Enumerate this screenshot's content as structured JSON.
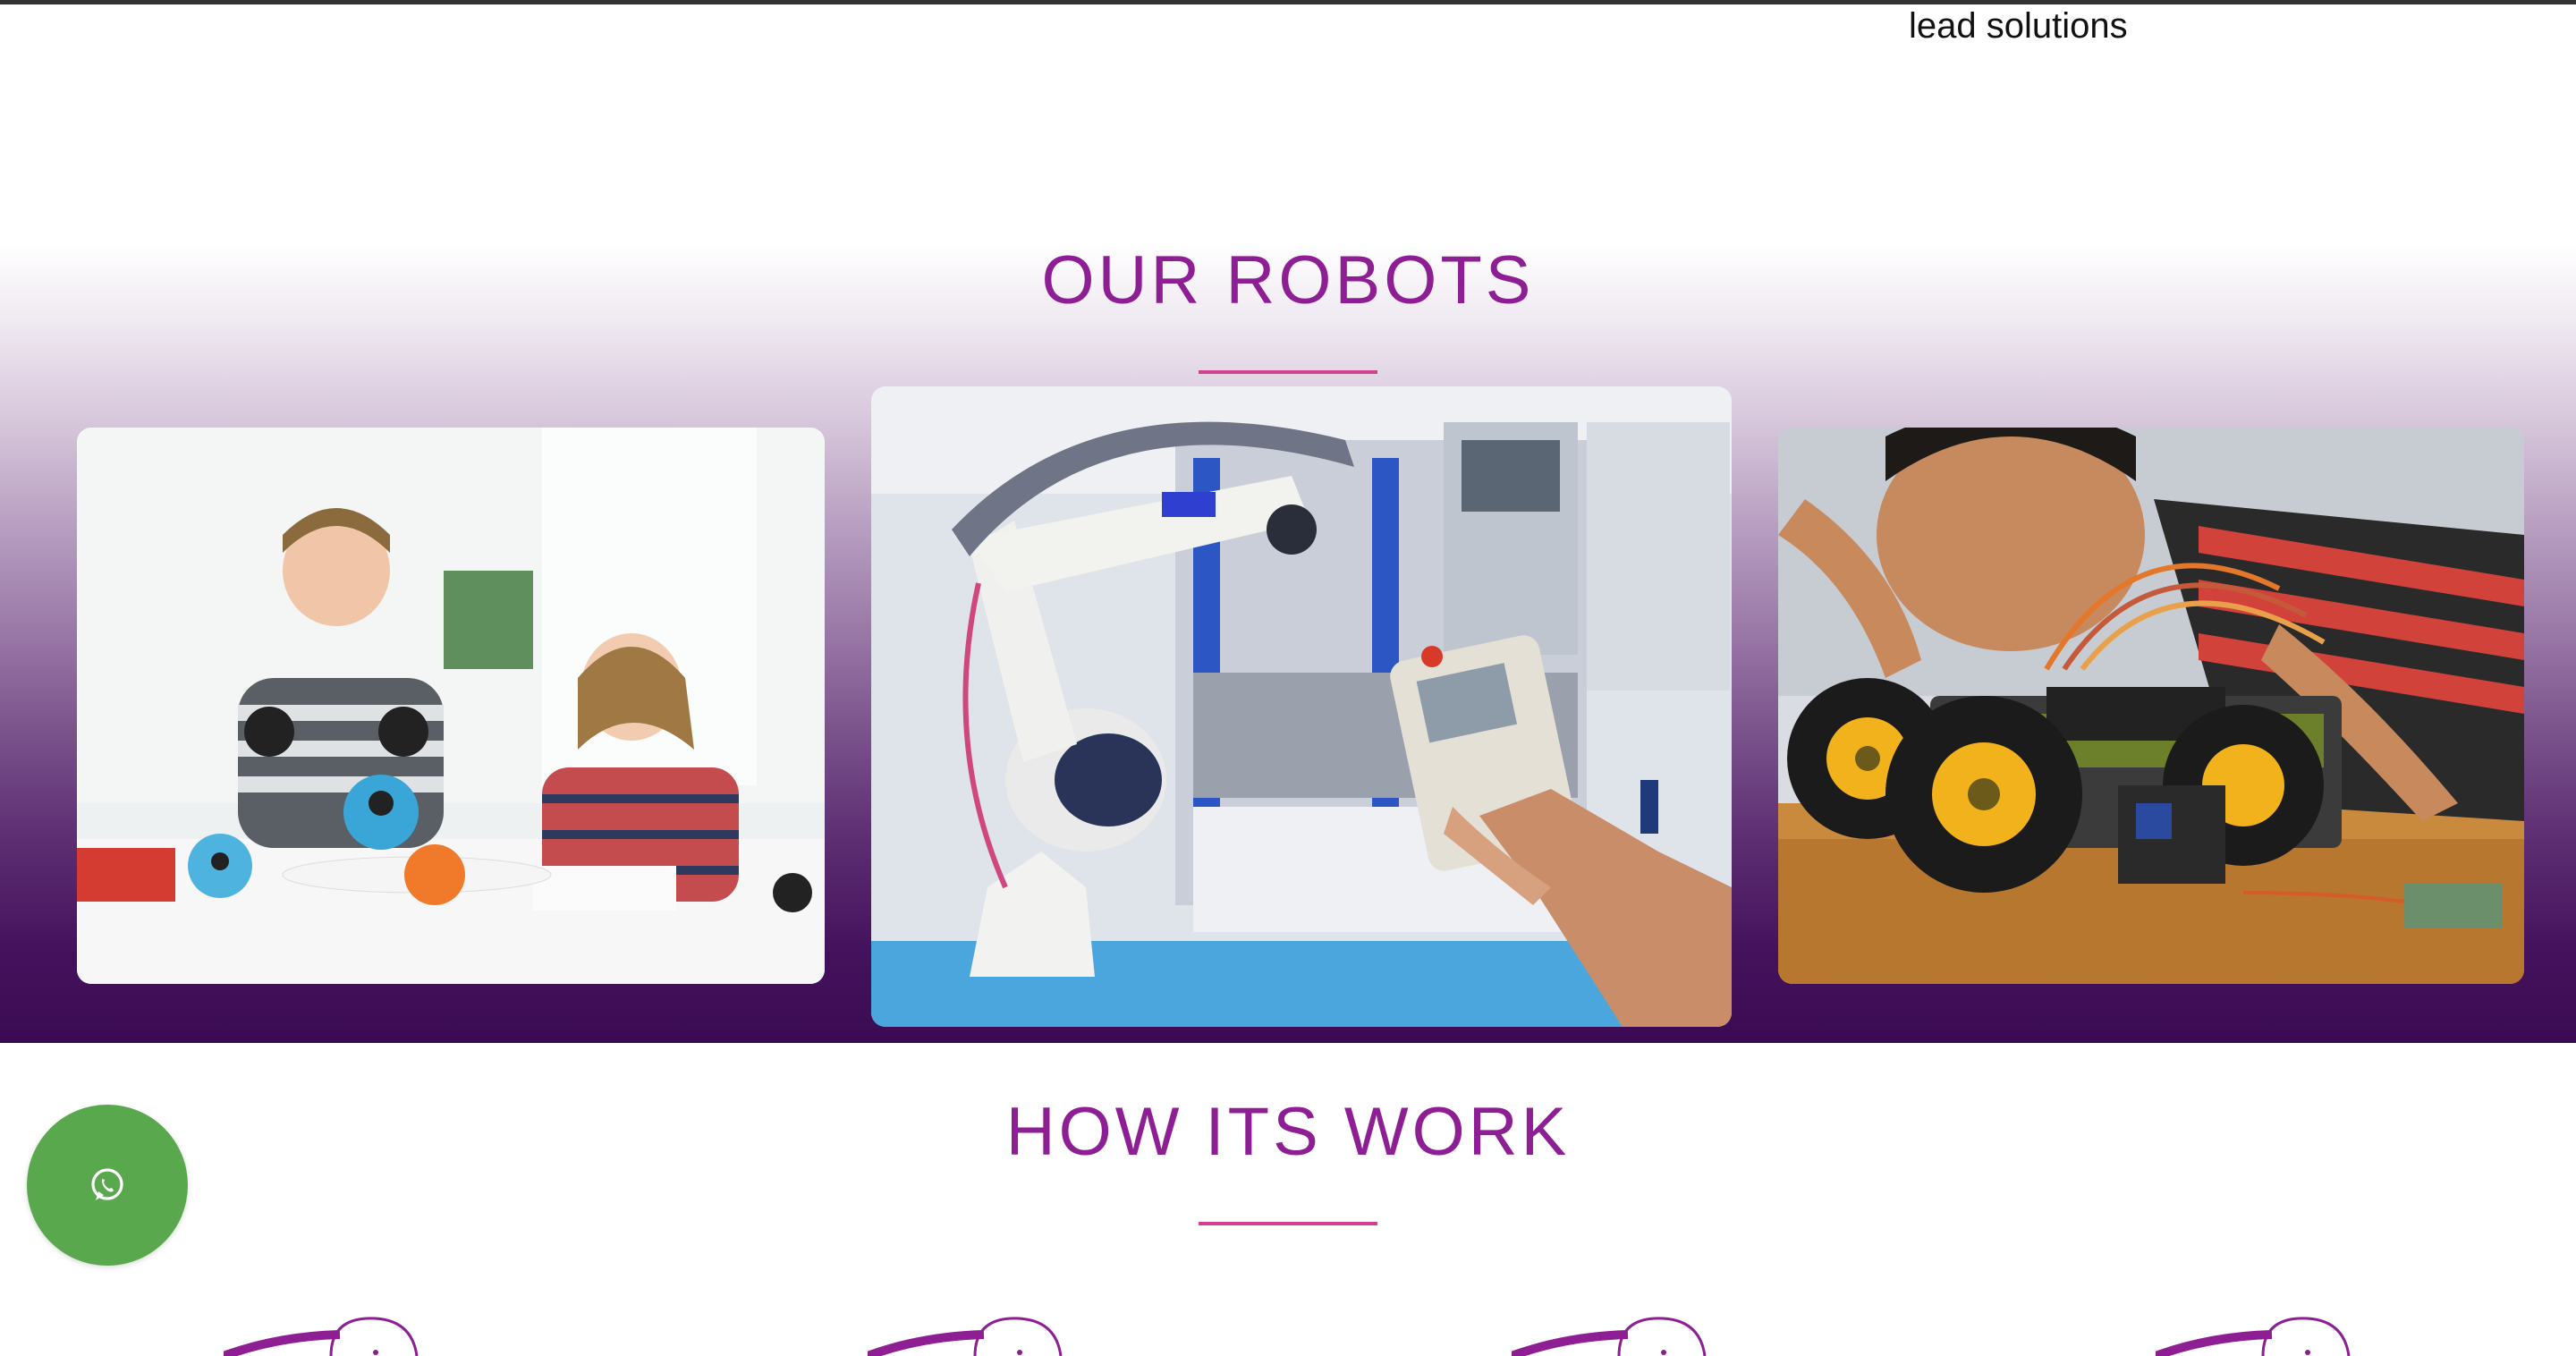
{
  "header": {
    "partial_text": "lead solutions"
  },
  "robots_section": {
    "title": "OUR ROBOTS",
    "cards": [
      {
        "alt": "children-playing-with-toy-robots"
      },
      {
        "alt": "industrial-robot-arm-with-controller"
      },
      {
        "alt": "boy-building-robot-car"
      }
    ]
  },
  "how_section": {
    "title": "HOW ITS WORK"
  },
  "floating": {
    "icon": "whatsapp-icon"
  },
  "colors": {
    "accent_purple": "#8e1e93",
    "underline_pink": "#d2408f",
    "whatsapp_green": "#5aa84e",
    "section_dark": "#3a0a52"
  }
}
